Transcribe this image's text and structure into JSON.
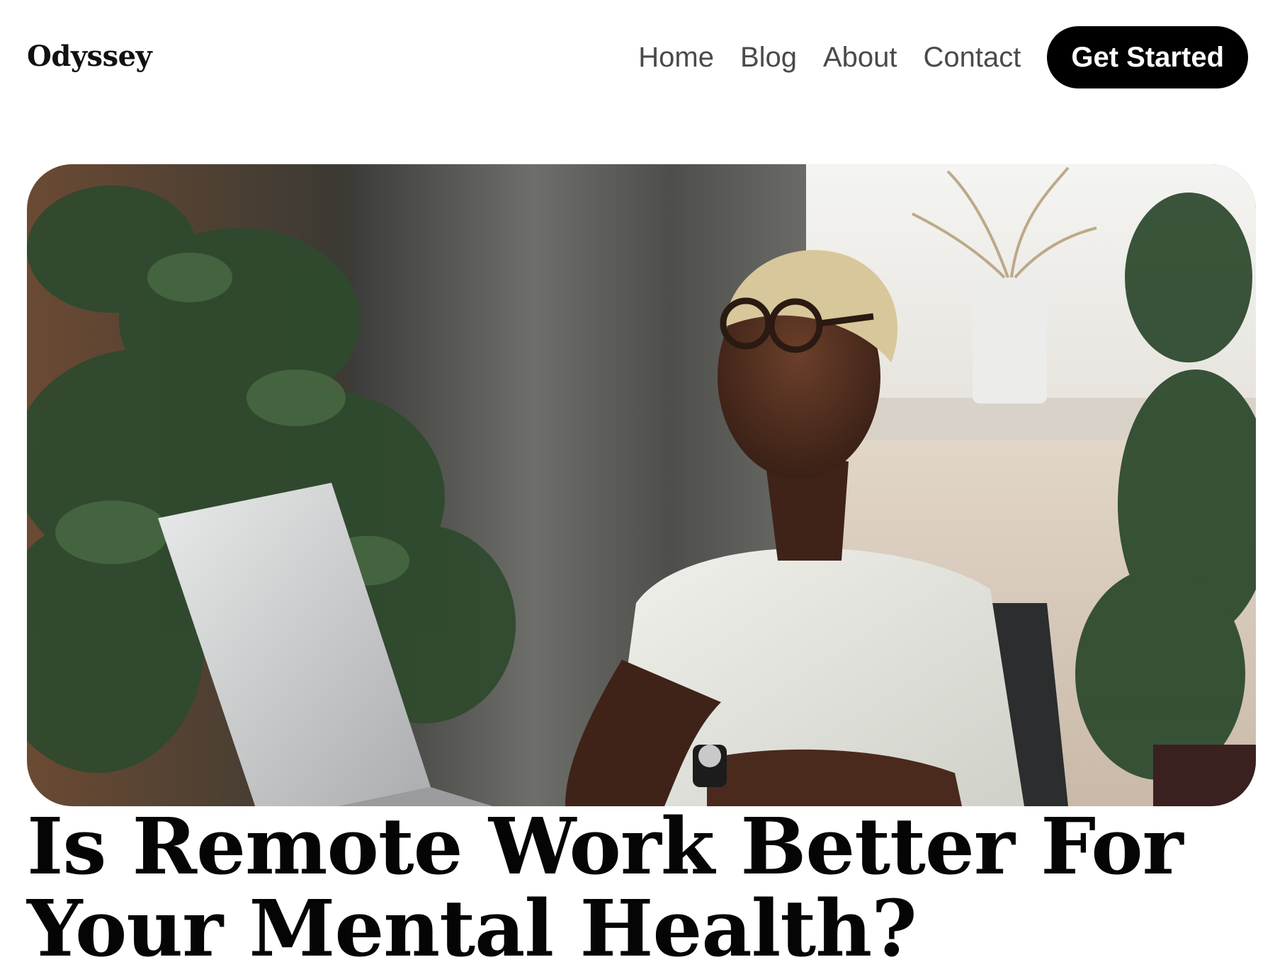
{
  "header": {
    "logo": "Odyssey",
    "nav": [
      "Home",
      "Blog",
      "About",
      "Contact"
    ],
    "cta_label": "Get Started"
  },
  "hero": {
    "image_icon": "hero-photo"
  },
  "article": {
    "title": "Is Remote Work Better For Your Mental Health?"
  },
  "colors": {
    "background": "#ffffff",
    "cta_background": "#000000",
    "cta_text": "#ffffff",
    "nav_text": "#4a4a4a"
  }
}
